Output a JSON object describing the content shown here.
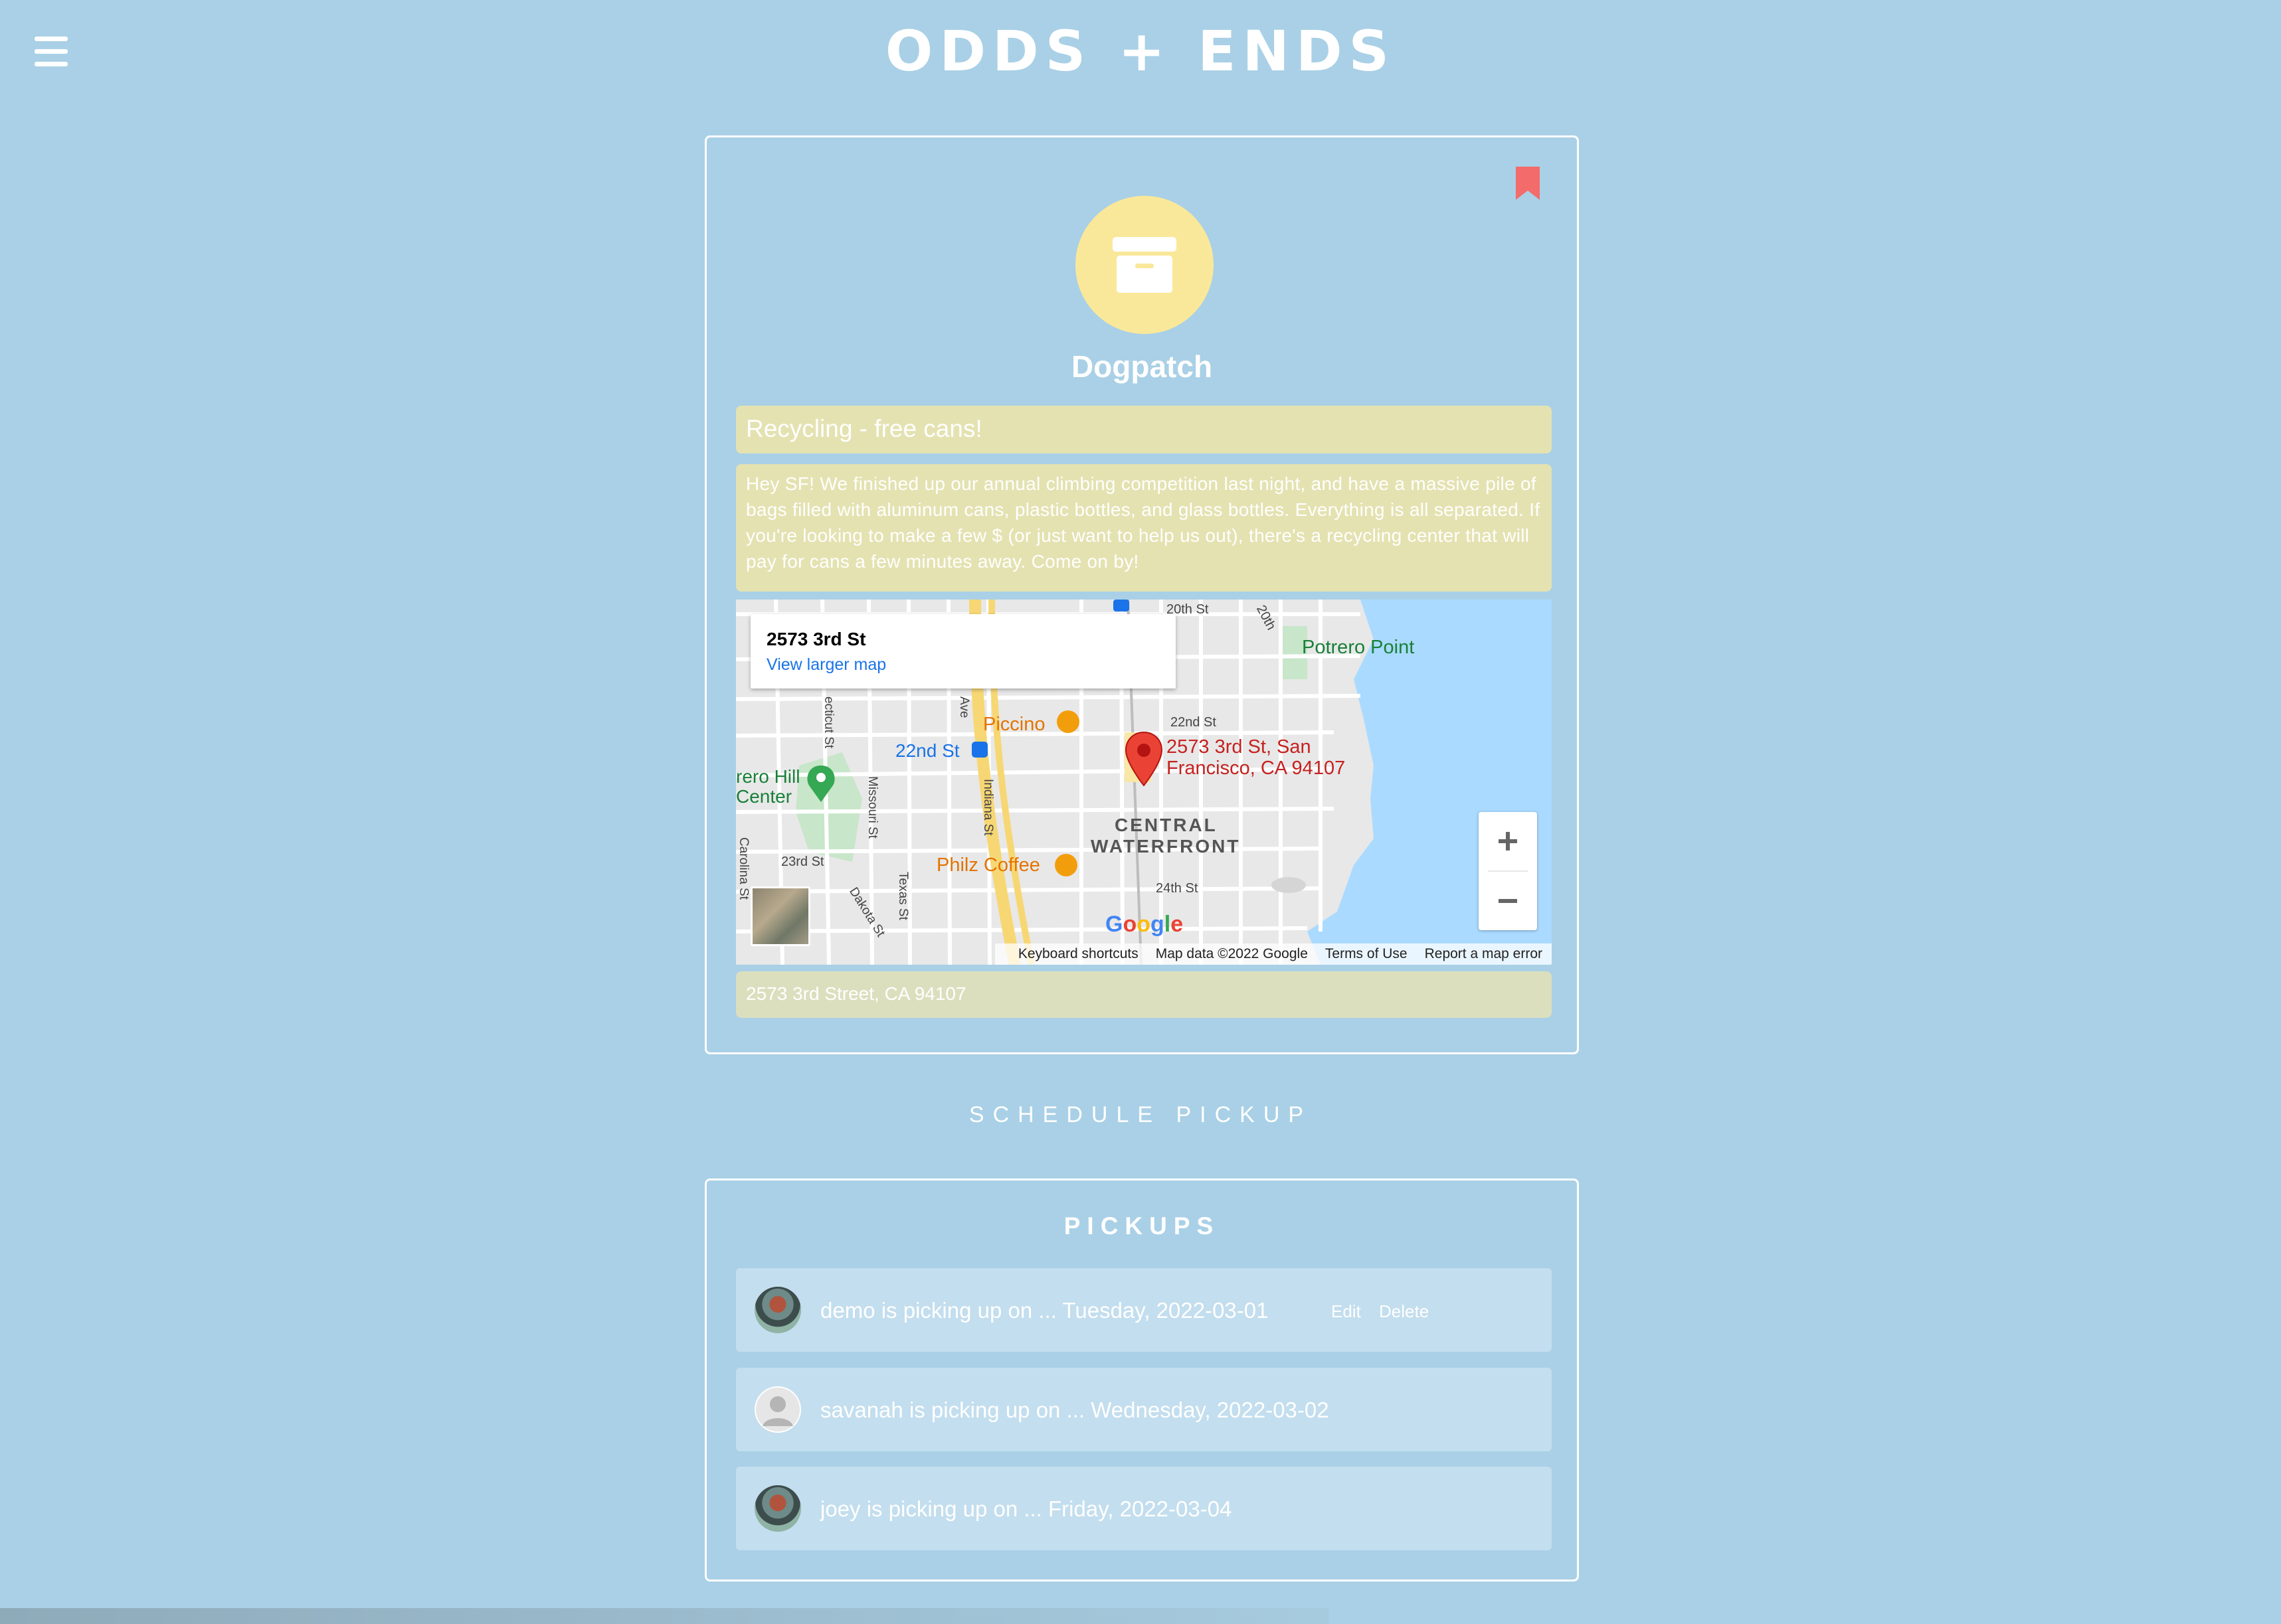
{
  "header": {
    "title": "ODDS + ENDS"
  },
  "post": {
    "neighborhood": "Dogpatch",
    "title": "Recycling - free cans!",
    "body": "Hey SF! We finished up our annual climbing competition last night, and have a massive pile of bags filled with aluminum cans, plastic bottles, and glass bottles. Everything is all separated. If you're looking to make a few $ (or just want to help us out), there's a recycling center that will pay for cans a few minutes away. Come on by!",
    "address": "2573 3rd Street, CA 94107"
  },
  "map": {
    "popup_title": "2573 3rd St",
    "popup_link": "View larger map",
    "pin_label_line1": "2573 3rd St, San",
    "pin_label_line2": "Francisco, CA 94107",
    "labels": {
      "potrero_point": "Potrero Point",
      "piccino": "Piccino",
      "station_22nd": "22nd St",
      "central": "CENTRAL",
      "waterfront": "WATERFRONT",
      "philz": "Philz Coffee",
      "rec_center_1": "rero Hill",
      "rec_center_2": "Center",
      "st_20th": "20th St",
      "st_20th_b": "20th",
      "st_22nd": "22nd St",
      "st_23rd": "23rd St",
      "st_24th": "24th St",
      "indiana": "Indiana St",
      "missouri": "Missouri St",
      "texas": "Texas St",
      "dakota": "Dakota St",
      "carolina": "Carolina St",
      "connecticut": "ecticut St",
      "ave": "Ave"
    },
    "logo": "Google",
    "footer": [
      "Keyboard shortcuts",
      "Map data ©2022 Google",
      "Terms of Use",
      "Report a map error"
    ],
    "zoom_in": "+",
    "zoom_out": "−"
  },
  "schedule_label": "SCHEDULE PICKUP",
  "pickups": {
    "title": "PICKUPS",
    "edit_label": "Edit",
    "delete_label": "Delete",
    "items": [
      {
        "text": "demo is picking up on ... Tuesday, 2022-03-01"
      },
      {
        "text": "savanah is picking up on ... Wednesday, 2022-03-02"
      },
      {
        "text": "joey is picking up on ... Friday, 2022-03-04"
      }
    ]
  },
  "colors": {
    "background": "#a9d0e6",
    "field": "#e4e2b1",
    "avatar_circle": "#fae89a",
    "bookmark": "#f36b6b",
    "pickup_row": "#c3deee"
  },
  "icons": [
    "menu-icon",
    "bookmark-icon",
    "archive-box-icon",
    "map-pin-icon",
    "default-user-icon"
  ]
}
